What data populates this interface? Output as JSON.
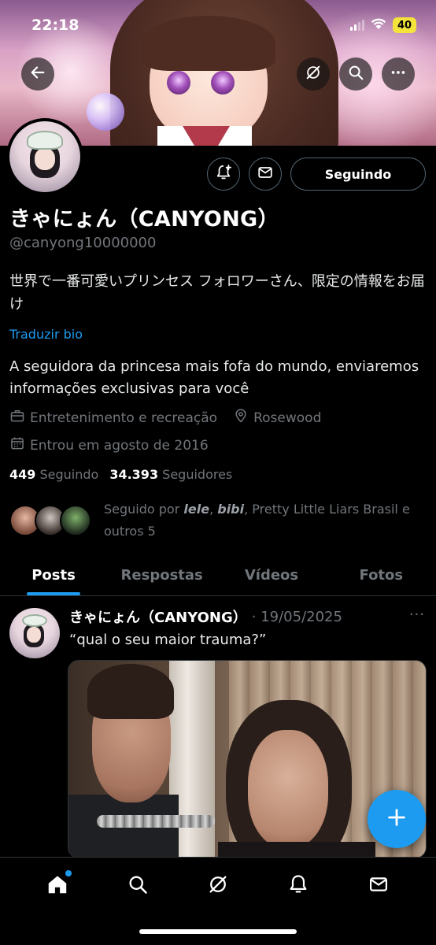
{
  "status_bar": {
    "time": "22:18",
    "battery": "40"
  },
  "header": {
    "back_icon": "arrow-left-icon",
    "grok_icon": "grok-icon",
    "search_icon": "search-icon",
    "more_icon": "more-icon"
  },
  "profile": {
    "name": "きゃにょん（CANYONG）",
    "handle": "@canyong10000000",
    "bio_original": "世界で一番可愛いプリンセス フォロワーさん、限定の情報をお届け",
    "translate_label": "Traduzir bio",
    "bio_translated": "A seguidora da princesa mais fofa do mundo, enviaremos informações exclusivas para você",
    "category": "Entretenimento e recreação",
    "location": "Rosewood",
    "joined": "Entrou em agosto de 2016",
    "following_count": "449",
    "following_label": "Seguindo",
    "followers_count": "34.393",
    "followers_label": "Seguidores",
    "follow_button": "Seguindo",
    "mutuals_prefix": "Seguido por ",
    "mutual_1": "lele",
    "mutual_sep": ", ",
    "mutual_2": "bibi",
    "mutuals_suffix": ", Pretty Little Liars Brasil e outros 5"
  },
  "tabs": [
    {
      "label": "Posts"
    },
    {
      "label": "Respostas"
    },
    {
      "label": "Vídeos"
    },
    {
      "label": "Fotos"
    }
  ],
  "tweet": {
    "author": "きゃにょん（CANYONG）",
    "date": "· 19/05/2025",
    "more": "···",
    "text": "“qual o seu maior trauma?”"
  },
  "colors": {
    "accent": "#1d9bf0",
    "muted": "#71767b",
    "background": "#000000"
  },
  "bottom_nav": [
    "home-icon",
    "search-icon",
    "grok-icon",
    "notifications-icon",
    "messages-icon"
  ]
}
